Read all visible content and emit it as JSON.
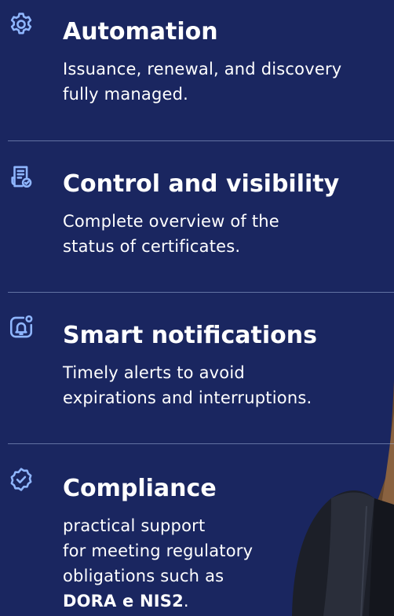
{
  "colors": {
    "background": "#1a2660",
    "icon": "#8fb6ff",
    "text": "#ffffff",
    "divider": "#aabee6"
  },
  "features": [
    {
      "icon": "gear-icon",
      "title": "Automation",
      "description_line1": "Issuance, renewal, and discovery",
      "description_line2": "fully managed."
    },
    {
      "icon": "certificate-document-icon",
      "title": "Control and visibility",
      "description_line1": "Complete overview of the",
      "description_line2": "status of certificates."
    },
    {
      "icon": "notification-bell-icon",
      "title": "Smart notifications",
      "description_line1": "Timely alerts to avoid",
      "description_line2": "expirations and interruptions."
    },
    {
      "icon": "check-badge-icon",
      "title": "Compliance",
      "description_line1": "practical support",
      "description_line2": "for meeting regulatory",
      "description_line3": "obligations such as",
      "description_strong": "DORA e NIS2",
      "description_end": "."
    }
  ]
}
